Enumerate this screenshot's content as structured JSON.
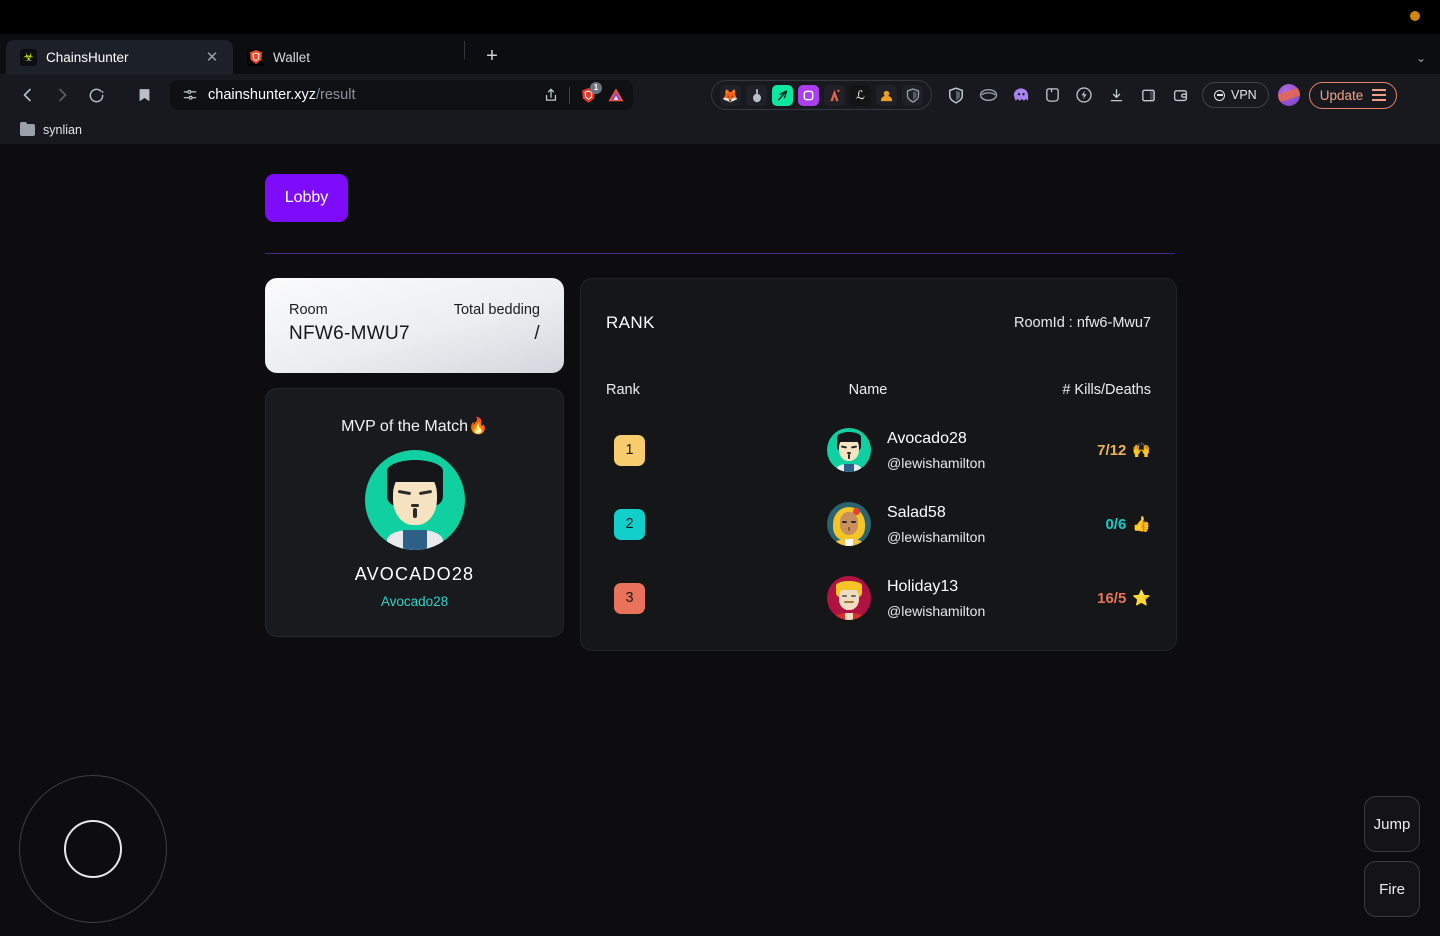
{
  "browser": {
    "tabs": [
      {
        "title": "ChainsHunter",
        "favicon": "chainshunter-icon",
        "active": true,
        "close_label": "✕"
      },
      {
        "title": "Wallet",
        "favicon": "brave-wallet-icon",
        "active": false
      }
    ],
    "new_tab_label": "+",
    "tab_list_label": "⌄",
    "nav": {
      "back_label": "‹",
      "forward_label": "›",
      "reload_label": "⟳",
      "bookmark_label": "bookmark-icon"
    },
    "omnibox": {
      "domain": "chainshunter.xyz",
      "path": "/result",
      "permissions_icon": "site-settings-icon",
      "share_icon": "share-icon",
      "shield_icon": "brave-shields-icon",
      "shield_count": "1",
      "leo_icon": "leo-ai-icon"
    },
    "extensions": [
      {
        "name": "metamask-icon",
        "glyph": "🦊",
        "bg": "#1f2127"
      },
      {
        "name": "keplr-icon",
        "glyph": "🔘",
        "bg": "#1f2127"
      },
      {
        "name": "sui-wallet-icon",
        "glyph": "✅",
        "bg": "#0ce8a0"
      },
      {
        "name": "phantom-icon",
        "glyph": "▣",
        "bg": "#ab3cf0"
      },
      {
        "name": "argent-icon",
        "glyph": "🅰",
        "bg": "#1f2127"
      },
      {
        "name": "leather-icon",
        "glyph": "Ł",
        "bg": "#1a1a1a"
      },
      {
        "name": "braavos-icon",
        "glyph": "🦁",
        "bg": "#1f2127"
      },
      {
        "name": "guard-icon",
        "glyph": "🛡",
        "bg": "#1f2127"
      }
    ],
    "toolbar_icons": [
      {
        "name": "shield-icon",
        "glyph": "🛡"
      },
      {
        "name": "rabby-icon",
        "glyph": "◯"
      },
      {
        "name": "ghost-wallet-icon",
        "glyph": "👻"
      },
      {
        "name": "keplr-wallet-icon",
        "glyph": "⬠"
      },
      {
        "name": "brave-rewards-icon",
        "glyph": "◍"
      },
      {
        "name": "downloads-icon",
        "glyph": "⤓"
      },
      {
        "name": "sidebar-icon",
        "glyph": "▯"
      },
      {
        "name": "brave-wallet-icon",
        "glyph": "▤"
      }
    ],
    "vpn_label": "VPN",
    "update_label": "Update",
    "bookmarks": [
      {
        "label": "synlian",
        "icon": "folder-icon"
      }
    ]
  },
  "app": {
    "lobby_button": "Lobby",
    "room_card": {
      "room_label": "Room",
      "room_value": "NFW6-MWU7",
      "bedding_label": "Total bedding",
      "bedding_value": "/"
    },
    "mvp_card": {
      "title": "MVP of the Match🔥",
      "avatar_name": "mvp-avatar",
      "name": "AVOCADO28",
      "handle": "Avocado28"
    },
    "rank_card": {
      "title": "RANK",
      "room_id": "RoomId : nfw6-Mwu7",
      "columns": {
        "rank": "Rank",
        "name": "Name",
        "kd": "# Kills/Deaths"
      },
      "rows": [
        {
          "rank": "1",
          "badge_color": "#f9cc6e",
          "name": "Avocado28",
          "handle": "@lewishamilton",
          "kd": "7/12",
          "kd_color": "#f0b44e",
          "emoji": "🙌",
          "avatar": {
            "bg": "#10cfa0",
            "hair": "#15161a",
            "face": "#f5e3c2",
            "body": "#e8eaee"
          }
        },
        {
          "rank": "2",
          "badge_color": "#12cfcb",
          "name": "Salad58",
          "handle": "@lewishamilton",
          "kd": "0/6",
          "kd_color": "#12cfcb",
          "emoji": "👍",
          "avatar": {
            "bg": "#2b6470",
            "hair": "#f5c528",
            "face": "#c98f5e",
            "body": "#f2c640"
          }
        },
        {
          "rank": "3",
          "badge_color": "#e8735a",
          "name": "Holiday13",
          "handle": "@lewishamilton",
          "kd": "16/5",
          "kd_color": "#e8735a",
          "emoji": "⭐",
          "avatar": {
            "bg": "#b01340",
            "hair": "#f5c528",
            "face": "#f0dcc0",
            "body": "#d4342e"
          }
        }
      ]
    },
    "controls": {
      "joystick_label": "movement-joystick",
      "jump_label": "Jump",
      "fire_label": "Fire"
    }
  }
}
